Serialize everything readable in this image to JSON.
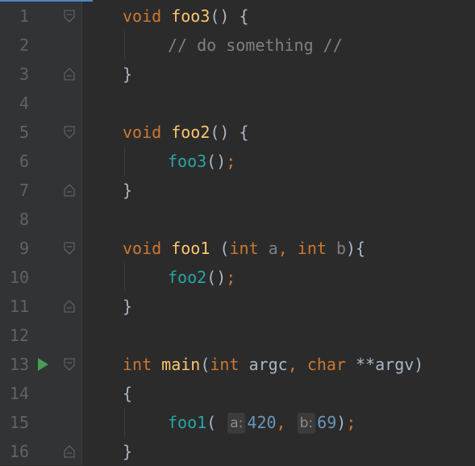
{
  "gutter": {
    "line_numbers": [
      "1",
      "2",
      "3",
      "4",
      "5",
      "6",
      "7",
      "8",
      "9",
      "10",
      "11",
      "12",
      "13",
      "14",
      "15",
      "16"
    ]
  },
  "code": {
    "foo3_kw": "void",
    "foo3_name": "foo3",
    "foo3_open": "() {",
    "comment": "// do something //",
    "foo3_close": "}",
    "foo2_kw": "void",
    "foo2_name": "foo2",
    "foo2_open": "() {",
    "foo2_call": "foo3",
    "foo2_call_args": "()",
    "foo2_semi": ";",
    "foo2_close": "}",
    "foo1_kw": "void",
    "foo1_name": "foo1",
    "foo1_open": " (",
    "foo1_int1": "int",
    "foo1_a": " a",
    "foo1_comma": ", ",
    "foo1_int2": "int",
    "foo1_b": " b",
    "foo1_tail": "){",
    "foo1_call": "foo2",
    "foo1_call_args": "()",
    "foo1_semi": ";",
    "foo1_close": "}",
    "main_kw": "int",
    "main_name": " main",
    "main_paren": "(",
    "main_int": "int",
    "main_argc": " argc",
    "main_comma": ", ",
    "main_char": "char",
    "main_argv": " **argv)",
    "main_brace_open": "{",
    "main_call": "foo1",
    "main_call_paren": "( ",
    "hint_a": "a:",
    "arg_a": "420",
    "arg_comma": ", ",
    "hint_b": "b:",
    "arg_b": "69",
    "main_call_close": ")",
    "main_semi": ";",
    "main_brace_close": "}"
  },
  "icons": {
    "run": "run-gutter-icon",
    "fold_start": "fold-start-icon",
    "fold_end": "fold-end-icon"
  },
  "colors": {
    "background": "#2b2b2b",
    "gutter": "#313335",
    "keyword": "#cc7832",
    "function_decl": "#ffc66d",
    "function_call": "#26a6a6",
    "comment": "#808080",
    "number": "#6897bb",
    "text": "#a9b7c6",
    "run_icon": "#499c54"
  }
}
